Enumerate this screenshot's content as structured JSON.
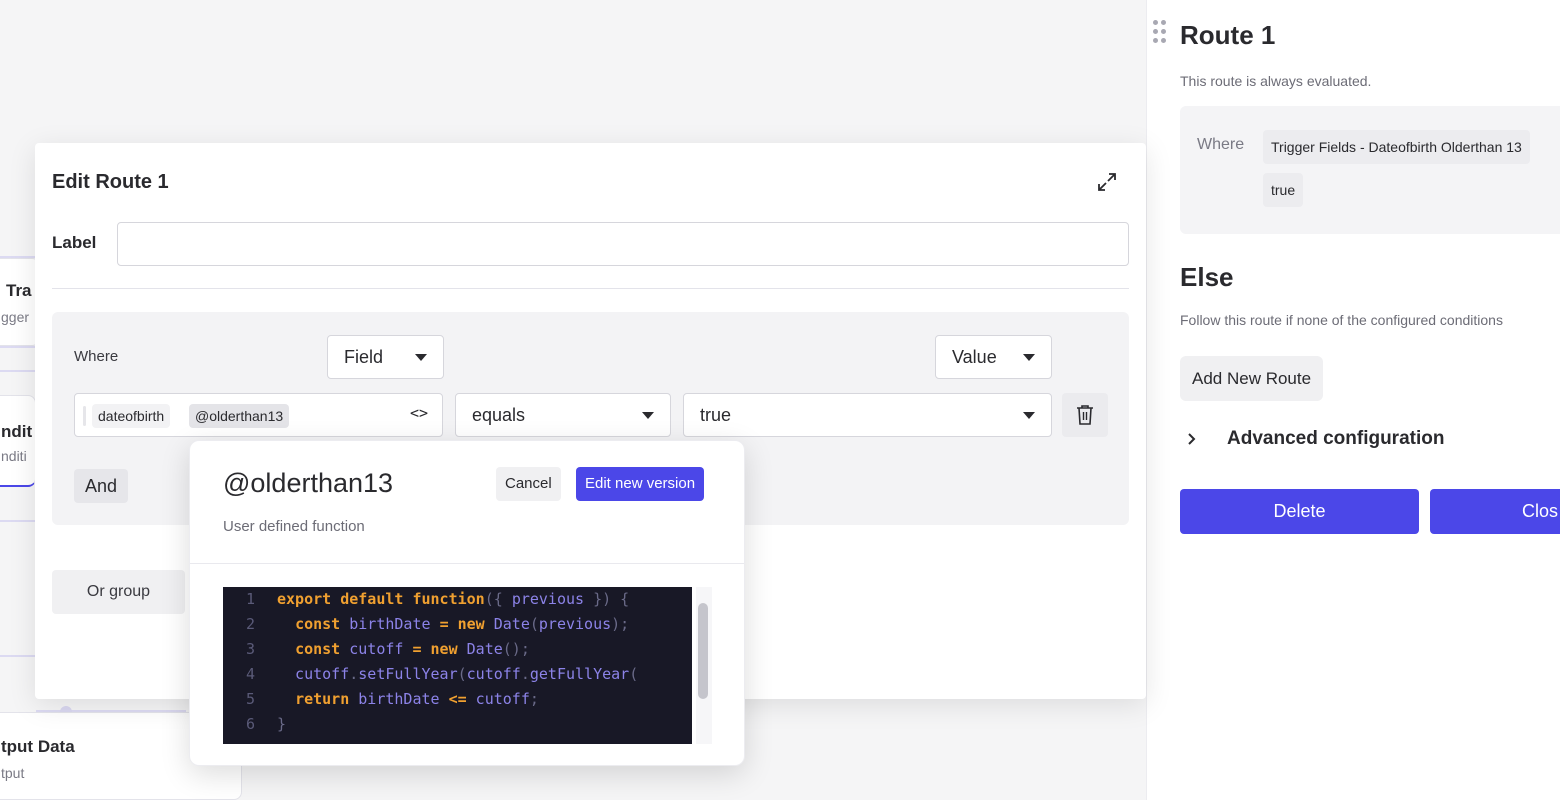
{
  "canvas": {
    "nodes": [
      {
        "title": "Tra",
        "subtitle": "gger"
      },
      {
        "title": "ndit",
        "subtitle": "nditi"
      },
      {
        "title": "tput Data",
        "subtitle": "tput"
      }
    ]
  },
  "right_panel": {
    "title": "Route 1",
    "description": "This route is always evaluated.",
    "where_label": "Where",
    "condition_field": "Trigger Fields - Dateofbirth Olderthan 13",
    "condition_value": "true",
    "else_title": "Else",
    "else_description": "Follow this route if none of the configured conditions",
    "add_route_label": "Add New Route",
    "advanced_label": "Advanced configuration",
    "delete_label": "Delete",
    "close_label": "Clos"
  },
  "modal": {
    "title": "Edit Route 1",
    "label_caption": "Label",
    "label_value": "",
    "where_label": "Where",
    "field_select": "Field",
    "value_select": "Value",
    "field_tokens": [
      "dateofbirth",
      "@olderthan13"
    ],
    "operator": "equals",
    "value": "true",
    "and_label": "And",
    "or_group_label": "Or group"
  },
  "popover": {
    "title": "@olderthan13",
    "subtitle": "User defined function",
    "cancel_label": "Cancel",
    "edit_label": "Edit new version",
    "code_lines": [
      {
        "n": "1",
        "tokens": [
          {
            "t": "export default function",
            "c": "kw"
          },
          {
            "t": "({ ",
            "c": "pn"
          },
          {
            "t": "previous",
            "c": "id"
          },
          {
            "t": " }) {",
            "c": "pn"
          }
        ]
      },
      {
        "n": "2",
        "tokens": [
          {
            "t": "  ",
            "c": "pn"
          },
          {
            "t": "const",
            "c": "kw"
          },
          {
            "t": " birthDate ",
            "c": "id"
          },
          {
            "t": "=",
            "c": "kw"
          },
          {
            "t": " ",
            "c": "pn"
          },
          {
            "t": "new",
            "c": "kw"
          },
          {
            "t": " Date",
            "c": "id"
          },
          {
            "t": "(",
            "c": "pn"
          },
          {
            "t": "previous",
            "c": "id"
          },
          {
            "t": ");",
            "c": "pn"
          }
        ]
      },
      {
        "n": "3",
        "tokens": [
          {
            "t": "  ",
            "c": "pn"
          },
          {
            "t": "const",
            "c": "kw"
          },
          {
            "t": " cutoff ",
            "c": "id"
          },
          {
            "t": "=",
            "c": "kw"
          },
          {
            "t": " ",
            "c": "pn"
          },
          {
            "t": "new",
            "c": "kw"
          },
          {
            "t": " Date",
            "c": "id"
          },
          {
            "t": "();",
            "c": "pn"
          }
        ]
      },
      {
        "n": "4",
        "tokens": [
          {
            "t": "  cutoff",
            "c": "id"
          },
          {
            "t": ".",
            "c": "pn"
          },
          {
            "t": "setFullYear",
            "c": "id"
          },
          {
            "t": "(",
            "c": "pn"
          },
          {
            "t": "cutoff",
            "c": "id"
          },
          {
            "t": ".",
            "c": "pn"
          },
          {
            "t": "getFullYear",
            "c": "id"
          },
          {
            "t": "(",
            "c": "pn"
          }
        ]
      },
      {
        "n": "5",
        "tokens": [
          {
            "t": "  ",
            "c": "pn"
          },
          {
            "t": "return",
            "c": "kw"
          },
          {
            "t": " birthDate ",
            "c": "id"
          },
          {
            "t": "<=",
            "c": "kw"
          },
          {
            "t": " cutoff",
            "c": "id"
          },
          {
            "t": ";",
            "c": "pn"
          }
        ]
      },
      {
        "n": "6",
        "tokens": [
          {
            "t": "}",
            "c": "pn"
          }
        ]
      }
    ]
  },
  "colors": {
    "accent": "#4b47e8",
    "code_bg": "#181826",
    "code_keyword": "#f0a030",
    "code_identifier": "#8c83e8"
  },
  "icons": {
    "expand": "expand-icon",
    "trash": "trash-icon",
    "code": "code-icon",
    "drag": "drag-handle-icon",
    "chevron": "chevron-right-icon"
  }
}
